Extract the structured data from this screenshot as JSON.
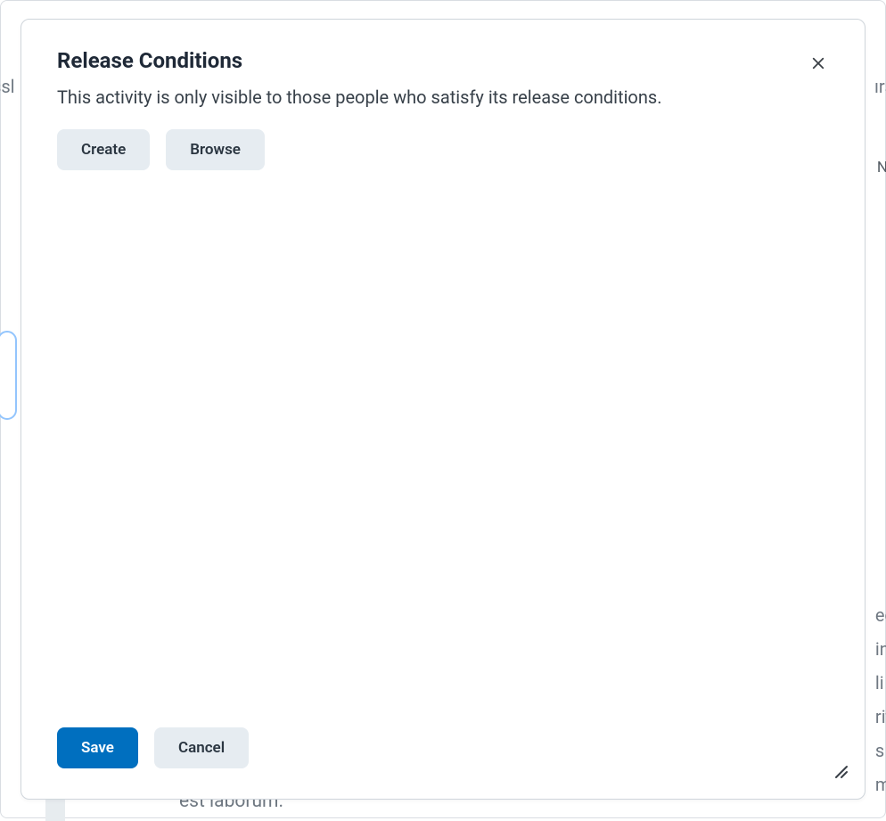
{
  "dialog": {
    "title": "Release Conditions",
    "description": "This activity is only visible to those people who satisfy its release conditions.",
    "create_label": "Create",
    "browse_label": "Browse",
    "save_label": "Save",
    "cancel_label": "Cancel"
  },
  "background": {
    "left_fragment": "ssl",
    "right_fragment": "ırs",
    "right_new_fragment": "Ne",
    "right_col": "ec\nin\nli\nrit\ns\nm",
    "bottom_fragment": "est laborum."
  }
}
